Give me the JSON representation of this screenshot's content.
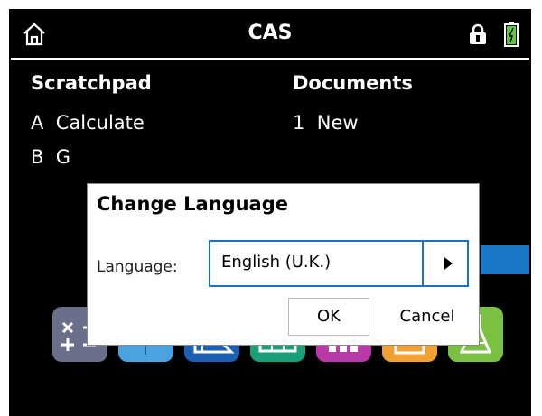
{
  "topbar": {
    "title": "CAS"
  },
  "home": {
    "scratchpad_header": "Scratchpad",
    "scratchpad_items": [
      {
        "letter": "A",
        "label": "Calculate"
      },
      {
        "letter": "B",
        "label": "G"
      }
    ],
    "documents_header": "Documents",
    "document_items": [
      {
        "number": "1",
        "label": "New"
      }
    ]
  },
  "dialog": {
    "title": "Change Language",
    "language_label": "Language:",
    "selected_language": "English (U.K.)",
    "ok_label": "OK",
    "cancel_label": "Cancel"
  },
  "apps": [
    {
      "name": "calculator-app-icon",
      "color": "#6b6f8a"
    },
    {
      "name": "graphs-app-icon",
      "color": "#4aa3df"
    },
    {
      "name": "geometry-app-icon",
      "color": "#1a5fb4"
    },
    {
      "name": "lists-spreadsheet-app-icon",
      "color": "#1b9e7a"
    },
    {
      "name": "data-statistics-app-icon",
      "color": "#b83aa6"
    },
    {
      "name": "notes-app-icon",
      "color": "#f0a131"
    },
    {
      "name": "vernier-dataquest-app-icon",
      "color": "#79c043"
    }
  ],
  "colors": {
    "accent": "#1b6fc7",
    "highlight_bar": "#1a78c8"
  }
}
